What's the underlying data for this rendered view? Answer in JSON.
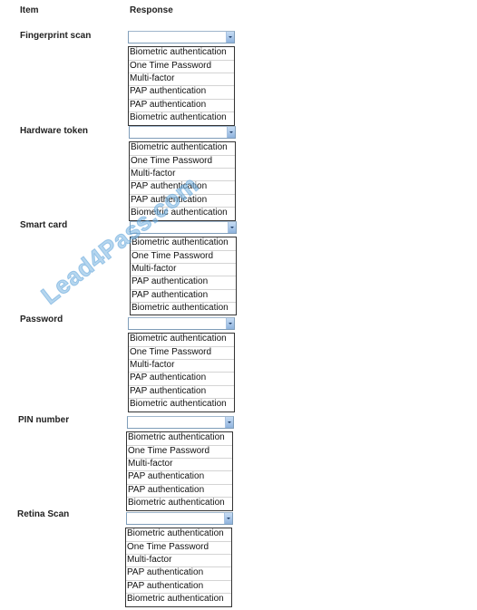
{
  "headers": {
    "item": "Item",
    "response": "Response"
  },
  "rows": [
    {
      "item": "Fingerprint scan",
      "selected": "",
      "options": [
        "Biometric authentication",
        "One Time Password",
        "Multi-factor",
        "PAP authentication",
        "PAP authentication",
        "Biometric authentication"
      ]
    },
    {
      "item": "Hardware token",
      "selected": "",
      "options": [
        "Biometric authentication",
        "One Time Password",
        "Multi-factor",
        "PAP authentication",
        "PAP authentication",
        "Biometric authentication"
      ]
    },
    {
      "item": "Smart card",
      "selected": "",
      "options": [
        "Biometric authentication",
        "One Time Password",
        "Multi-factor",
        "PAP authentication",
        "PAP authentication",
        "Biometric authentication"
      ]
    },
    {
      "item": "Password",
      "selected": "",
      "options": [
        "Biometric authentication",
        "One Time Password",
        "Multi-factor",
        "PAP authentication",
        "PAP authentication",
        "Biometric authentication"
      ]
    },
    {
      "item": "PIN number",
      "selected": "",
      "options": [
        "Biometric authentication",
        "One Time Password",
        "Multi-factor",
        "PAP authentication",
        "PAP authentication",
        "Biometric authentication"
      ]
    },
    {
      "item": "Retina Scan",
      "selected": "",
      "options": [
        "Biometric authentication",
        "One Time Password",
        "Multi-factor",
        "PAP authentication",
        "PAP authentication",
        "Biometric authentication"
      ]
    }
  ],
  "watermark": "Lead4Pass.com"
}
